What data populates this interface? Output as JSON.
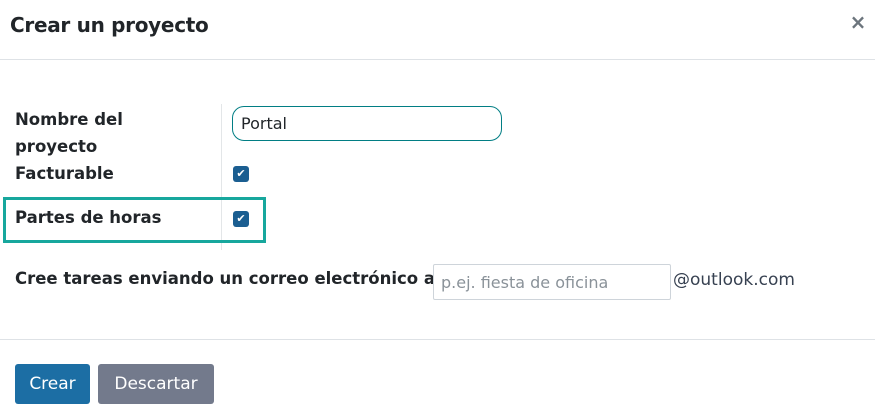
{
  "dialog": {
    "title": "Crear un proyecto",
    "close_glyph": "×"
  },
  "form": {
    "name_label": "Nombre del proyecto",
    "name_value": "Portal",
    "billable_label": "Facturable",
    "billable_checked": true,
    "timesheets_label": "Partes de horas",
    "timesheets_checked": true,
    "email_label": "Cree tareas enviando un correo electrónico a",
    "email_placeholder": "p.ej. fiesta de oficina",
    "email_domain": "@outlook.com",
    "check_glyph": "✔"
  },
  "footer": {
    "create_label": "Crear",
    "discard_label": "Descartar"
  },
  "colors": {
    "primary": "#1c6ea4",
    "secondary": "#737a8c",
    "highlight": "#17a79d",
    "checkbox": "#1b5e91"
  }
}
